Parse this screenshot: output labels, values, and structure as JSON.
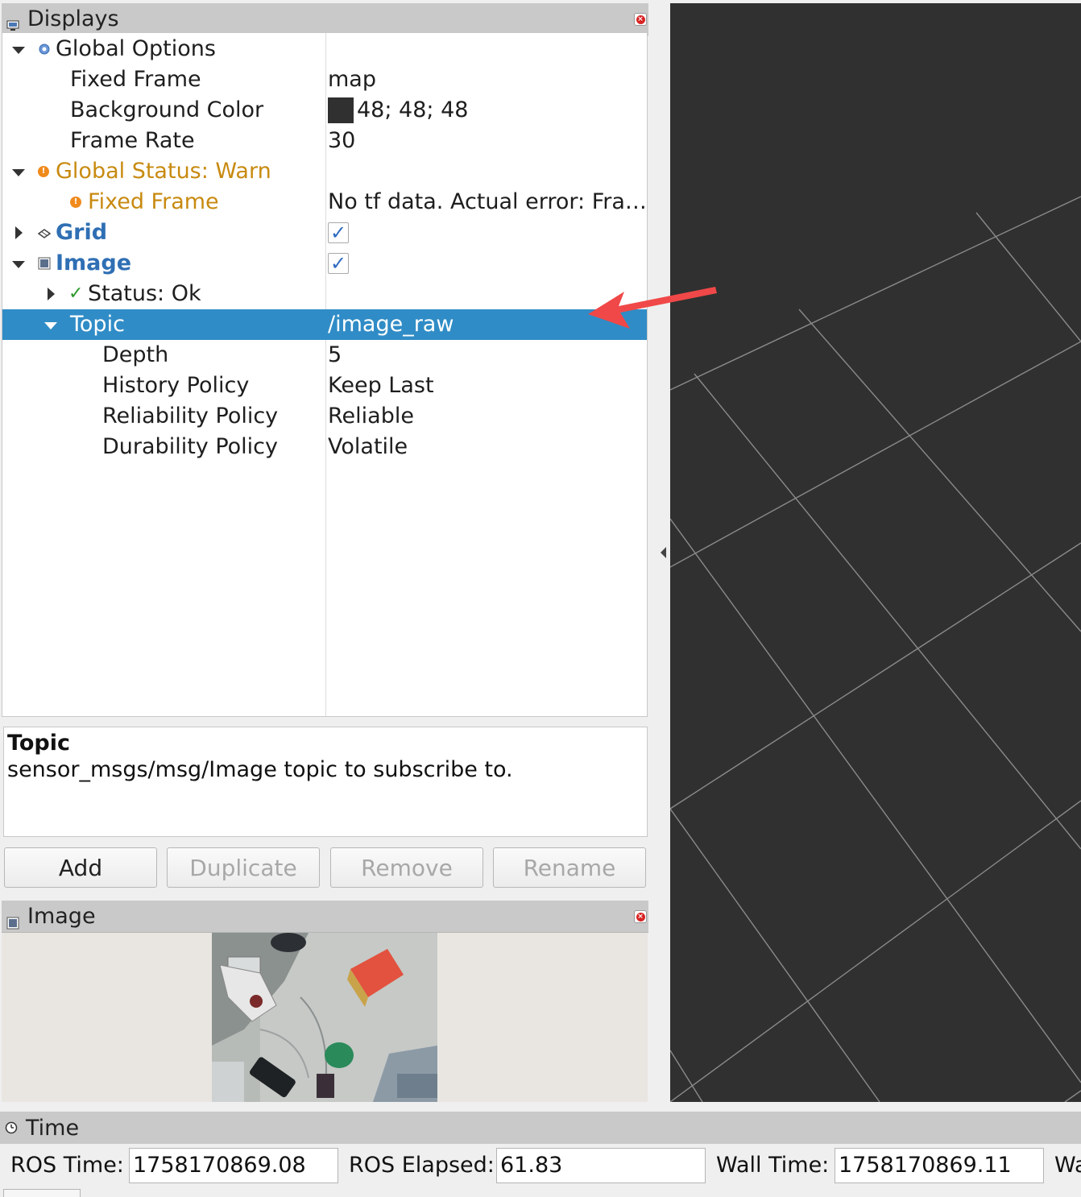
{
  "displays_panel": {
    "title": "Displays",
    "tree": [
      {
        "label": "Global Options",
        "value": ""
      },
      {
        "label": "Fixed Frame",
        "value": "map"
      },
      {
        "label": "Background Color",
        "value": "48; 48; 48",
        "swatch_color": "#303030"
      },
      {
        "label": "Frame Rate",
        "value": "30"
      },
      {
        "label": "Global Status: Warn",
        "value": ""
      },
      {
        "label": "Fixed Frame",
        "value": "No tf data.  Actual error: Fra…"
      },
      {
        "label": "Grid",
        "checked": true
      },
      {
        "label": "Image",
        "checked": true
      },
      {
        "label": "Status: Ok",
        "value": ""
      },
      {
        "label": "Topic",
        "value": "/image_raw",
        "selected": true
      },
      {
        "label": "Depth",
        "value": "5"
      },
      {
        "label": "History Policy",
        "value": "Keep Last"
      },
      {
        "label": "Reliability Policy",
        "value": "Reliable"
      },
      {
        "label": "Durability Policy",
        "value": "Volatile"
      }
    ],
    "check_glyph": "✓"
  },
  "help": {
    "title": "Topic",
    "text": "sensor_msgs/msg/Image topic to subscribe to."
  },
  "buttons": {
    "add": "Add",
    "duplicate": "Duplicate",
    "remove": "Remove",
    "rename": "Rename"
  },
  "image_panel": {
    "title": "Image"
  },
  "time_panel": {
    "title": "Time",
    "ros_time_label": "ROS Time:",
    "ros_time_value": "1758170869.08",
    "ros_elapsed_label": "ROS Elapsed:",
    "ros_elapsed_value": "61.83",
    "wall_time_label": "Wall Time:",
    "wall_time_value": "1758170869.11",
    "wall_elapsed_label_partial": "Wa"
  },
  "colors": {
    "selection": "#308cc6",
    "warn": "#c88a10",
    "display_name": "#2f6fb4",
    "view_background": "#303030",
    "annotation_arrow": "#f04848"
  }
}
